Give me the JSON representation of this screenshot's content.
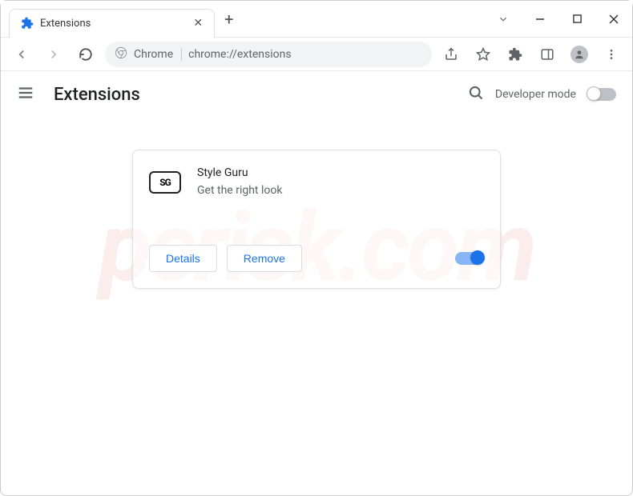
{
  "browser": {
    "tab_title": "Extensions",
    "address_prefix": "Chrome",
    "address_url": "chrome://extensions"
  },
  "page": {
    "title": "Extensions",
    "developer_mode_label": "Developer mode",
    "developer_mode_on": false
  },
  "extension": {
    "icon_text": "SG",
    "name": "Style Guru",
    "description": "Get the right look",
    "details_label": "Details",
    "remove_label": "Remove",
    "enabled": true
  }
}
